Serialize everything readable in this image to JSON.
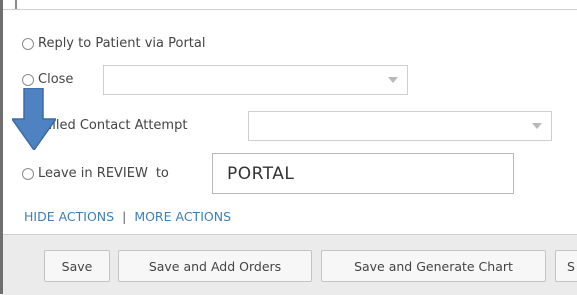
{
  "options": {
    "reply_portal": "Reply to Patient via Portal",
    "close": "Close",
    "failed_contact": "Failed Contact Attempt",
    "leave_review": "Leave in REVIEW",
    "leave_review_to": "to"
  },
  "close_select": {
    "value": ""
  },
  "failed_select": {
    "value": ""
  },
  "review_target": {
    "value": "PORTAL"
  },
  "links": {
    "hide_actions": "HIDE ACTIONS",
    "separator": "|",
    "more_actions": "MORE ACTIONS"
  },
  "footer_buttons": {
    "save": "Save",
    "save_add_orders": "Save and Add Orders",
    "save_generate_chart": "Save and Generate Chart",
    "partial": "S"
  },
  "colors": {
    "link": "#3e7fb6",
    "arrow": "#4f82c0",
    "footer_bg": "#ebebeb"
  },
  "icons": {
    "annotation_arrow": "arrow-down-icon",
    "dropdown": "chevron-down-icon"
  }
}
